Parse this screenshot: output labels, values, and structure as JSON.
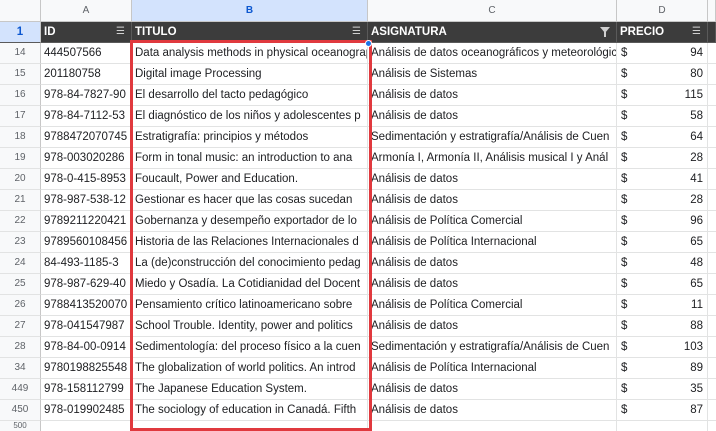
{
  "columns": {
    "letters": [
      "A",
      "B",
      "C",
      "D"
    ],
    "corner": ""
  },
  "header": {
    "row_number": "1",
    "id": "ID",
    "titulo": "TITULO",
    "asignatura": "ASIGNATURA",
    "precio": "PRECIO"
  },
  "rows": [
    {
      "n": "14",
      "id": "444507566",
      "titulo": "Data analysis methods in physical oceanography",
      "asignatura": "Análisis de datos oceanográficos y meteorológicos",
      "currency": "$",
      "precio": "94",
      "hl": false
    },
    {
      "n": "15",
      "id": "201180758",
      "titulo": "Digital image Processing",
      "asignatura": "Análisis de Sistemas",
      "currency": "$",
      "precio": "80",
      "hl": false
    },
    {
      "n": "16",
      "id": "978-84-7827-90",
      "titulo": "El desarrollo del tacto pedagógico",
      "asignatura": "Análisis de datos",
      "currency": "$",
      "precio": "115",
      "hl": false
    },
    {
      "n": "17",
      "id": "978-84-7112-53",
      "titulo": "El diagnóstico de los niños y adolescentes p",
      "asignatura": "Análisis de datos",
      "currency": "$",
      "precio": "58",
      "hl": false
    },
    {
      "n": "18",
      "id": "9788472070745",
      "titulo": "Estratigrafía: principios y métodos",
      "asignatura": "Sedimentación y estratigrafía/Análisis de Cuen",
      "currency": "$",
      "precio": "64",
      "hl": false
    },
    {
      "n": "19",
      "id": "978-003020286",
      "titulo": "Form in tonal music: an introduction to ana",
      "asignatura": "Armonía I, Armonía II, Análisis musical I y Anál",
      "currency": "$",
      "precio": "28",
      "hl": false
    },
    {
      "n": "20",
      "id": "978-0-415-8953",
      "titulo": "Foucault, Power and Education.",
      "asignatura": "Análisis de datos",
      "currency": "$",
      "precio": "41",
      "hl": false
    },
    {
      "n": "21",
      "id": "978-987-538-12",
      "titulo": "Gestionar es hacer que las cosas sucedan",
      "asignatura": "Análisis de datos",
      "currency": "$",
      "precio": "28",
      "hl": false
    },
    {
      "n": "22",
      "id": "9789211220421",
      "titulo": "Gobernanza y desempeño exportador de lo",
      "asignatura": "Análisis de Política Comercial",
      "currency": "$",
      "precio": "96",
      "hl": false
    },
    {
      "n": "23",
      "id": "9789560108456",
      "titulo": "Historia de las Relaciones Internacionales d",
      "asignatura": "Análisis de Política Internacional",
      "currency": "$",
      "precio": "65",
      "hl": false
    },
    {
      "n": "24",
      "id": "84-493-1185-3",
      "titulo": "La (de)construcción del conocimiento pedag",
      "asignatura": "Análisis de datos",
      "currency": "$",
      "precio": "48",
      "hl": false
    },
    {
      "n": "25",
      "id": "978-987-629-40",
      "titulo": "Miedo y Osadía. La Cotidianidad del Docent",
      "asignatura": "Análisis de datos",
      "currency": "$",
      "precio": "65",
      "hl": false
    },
    {
      "n": "26",
      "id": "9788413520070",
      "titulo": "Pensamiento crítico latinoamericano sobre",
      "asignatura": "Análisis de Política Comercial",
      "currency": "$",
      "precio": "11",
      "hl": false
    },
    {
      "n": "27",
      "id": "978-041547987",
      "titulo": "School Trouble. Identity, power and politics",
      "asignatura": "Análisis de datos",
      "currency": "$",
      "precio": "88",
      "hl": false
    },
    {
      "n": "28",
      "id": "978-84-00-0914",
      "titulo": "Sedimentología: del proceso físico a la cuen",
      "asignatura": "Sedimentación y estratigrafía/Análisis de Cuen",
      "currency": "$",
      "precio": "103",
      "hl": false
    },
    {
      "n": "34",
      "id": "9780198825548",
      "titulo": "The globalization of world politics. An introd",
      "asignatura": "Análisis de Política Internacional",
      "currency": "$",
      "precio": "89",
      "hl": false
    },
    {
      "n": "449",
      "id": "978-158112799",
      "titulo": "The Japanese Education System.",
      "asignatura": "Análisis de datos",
      "currency": "$",
      "precio": "35",
      "hl": false
    },
    {
      "n": "450",
      "id": "978-019902485",
      "titulo": "The sociology of education in Canadá. Fifth",
      "asignatura": "Análisis de datos",
      "currency": "$",
      "precio": "87",
      "hl": false
    }
  ],
  "footer_row": {
    "n": "500"
  },
  "colors": {
    "header_bg": "#3c3c3c",
    "selection_blue": "#1a73e8",
    "highlight_red": "#e0393e",
    "selected_col_header": "#d3e3fd"
  }
}
